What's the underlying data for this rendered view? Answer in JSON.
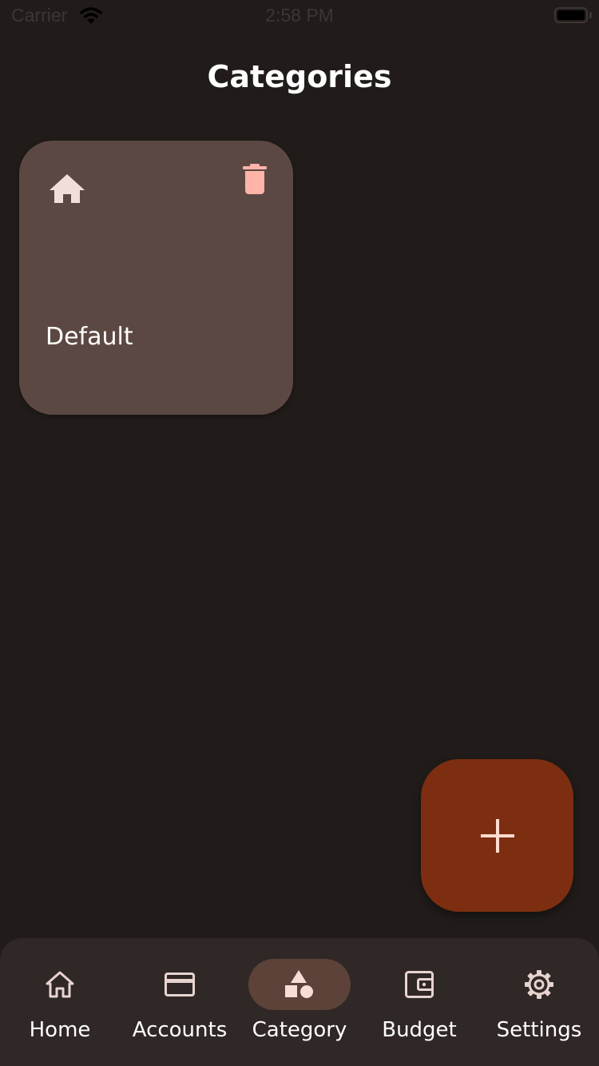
{
  "status_bar": {
    "carrier": "Carrier",
    "time": "2:58 PM"
  },
  "page": {
    "title": "Categories"
  },
  "categories": [
    {
      "name": "Default",
      "icon": "home-icon",
      "delete_icon": "trash-icon"
    }
  ],
  "fab": {
    "icon": "plus-icon"
  },
  "bottom_nav": {
    "items": [
      {
        "label": "Home",
        "icon": "home-outline-icon",
        "active": false
      },
      {
        "label": "Accounts",
        "icon": "credit-card-icon",
        "active": false
      },
      {
        "label": "Category",
        "icon": "shapes-icon",
        "active": true
      },
      {
        "label": "Budget",
        "icon": "wallet-icon",
        "active": false
      },
      {
        "label": "Settings",
        "icon": "gear-icon",
        "active": false
      }
    ]
  },
  "colors": {
    "background": "#211c1a",
    "card": "#5c4843",
    "delete": "#ffb4a9",
    "fab": "#7d2e10",
    "nav_background": "#302826",
    "nav_active_pill": "#5c4238",
    "icon_light": "#f0dedb"
  }
}
